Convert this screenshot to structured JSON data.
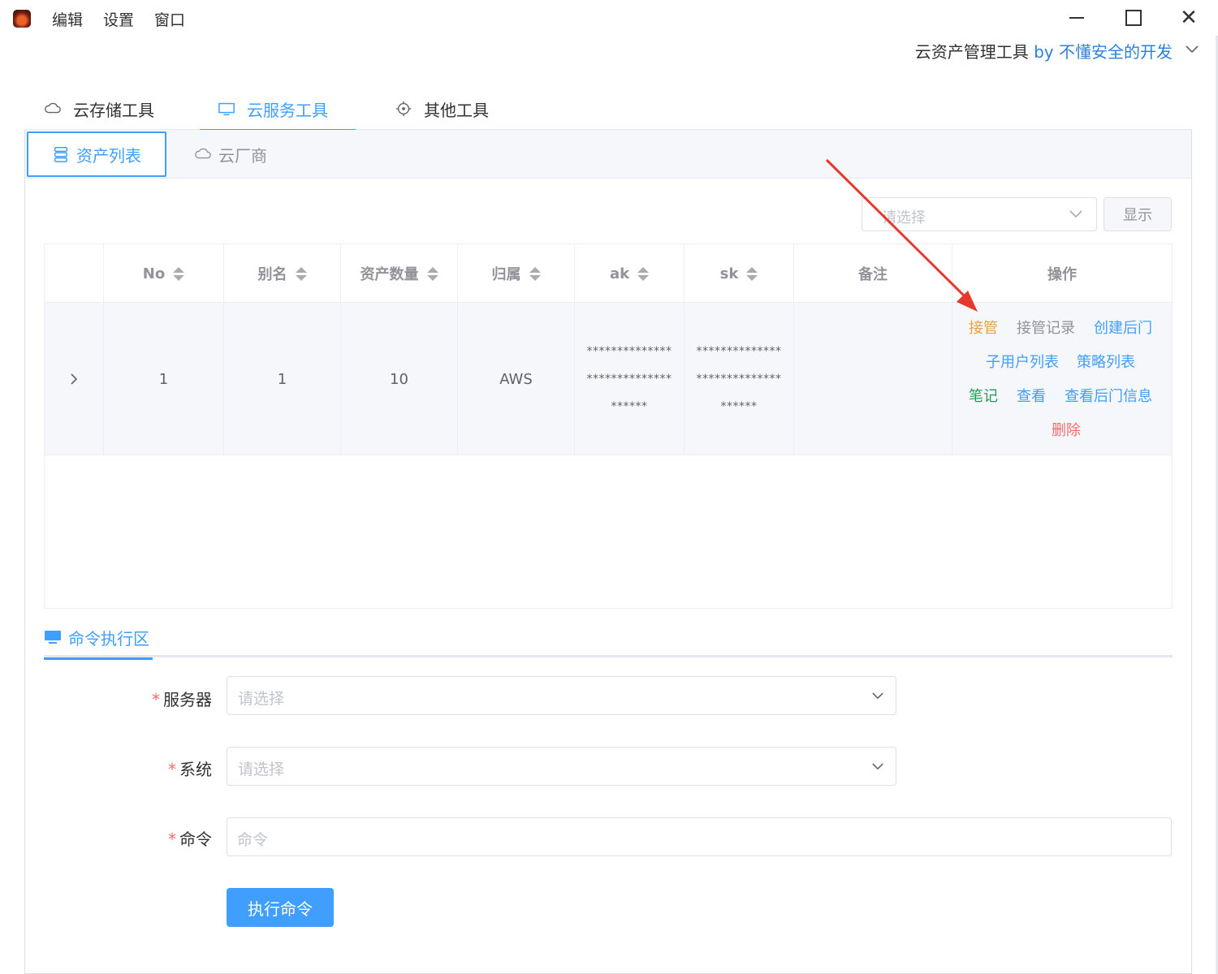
{
  "menu": [
    "编辑",
    "设置",
    "窗口"
  ],
  "brand": {
    "name": "云资产管理工具",
    "by": "by 不懂安全的开发"
  },
  "top_tabs": [
    {
      "label": "云存储工具",
      "icon": "cloud-icon",
      "active": false
    },
    {
      "label": "云服务工具",
      "icon": "monitor-icon",
      "active": true
    },
    {
      "label": "其他工具",
      "icon": "target-icon",
      "active": false
    }
  ],
  "sub_tabs": [
    {
      "label": "资产列表",
      "icon": "database-icon",
      "active": true
    },
    {
      "label": "云厂商",
      "icon": "cloud-icon",
      "active": false
    }
  ],
  "filter": {
    "placeholder": "请选择",
    "show_button": "显示"
  },
  "table": {
    "columns": [
      "No",
      "别名",
      "资产数量",
      "归属",
      "ak",
      "sk",
      "备注",
      "操作"
    ],
    "rows": [
      {
        "no": "1",
        "alias": "1",
        "asset_count": "10",
        "owner": "AWS",
        "ak": [
          "**************",
          "**************",
          "******"
        ],
        "sk": [
          "**************",
          "**************",
          "******"
        ],
        "note": "",
        "actions": [
          {
            "label": "接管",
            "color": "#e6a23c"
          },
          {
            "label": "接管记录",
            "color": "#909399"
          },
          {
            "label": "创建后门",
            "color": "#409eff"
          },
          {
            "label": "子用户列表",
            "color": "#409eff"
          },
          {
            "label": "策略列表",
            "color": "#409eff"
          },
          {
            "label": "笔记",
            "color": "#18a058"
          },
          {
            "label": "查看",
            "color": "#409eff"
          },
          {
            "label": "查看后门信息",
            "color": "#409eff"
          },
          {
            "label": "删除",
            "color": "#f56c6c"
          }
        ]
      }
    ]
  },
  "command_section": {
    "tab_label": "命令执行区",
    "fields": [
      {
        "label": "服务器",
        "required": true,
        "placeholder": "请选择"
      },
      {
        "label": "系统",
        "required": true,
        "placeholder": "请选择"
      },
      {
        "label": "命令",
        "required": true,
        "placeholder": "命令"
      }
    ],
    "execute_button": "执行命令"
  },
  "colors": {
    "accent": "#409eff",
    "annotation_arrow": "#e8382d"
  }
}
